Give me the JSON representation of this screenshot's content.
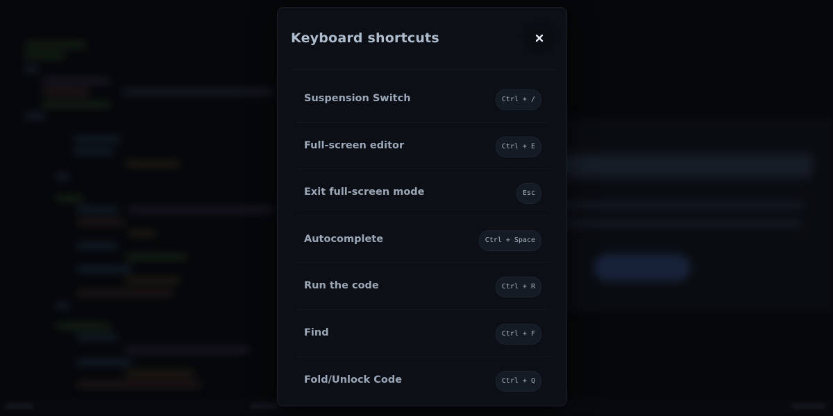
{
  "modal": {
    "title": "Keyboard shortcuts",
    "close_icon": "close-icon"
  },
  "shortcuts": [
    {
      "label": "Suspension Switch",
      "keys": "Ctrl + /"
    },
    {
      "label": "Full-screen editor",
      "keys": "Ctrl + E"
    },
    {
      "label": "Exit full-screen mode",
      "keys": "Esc"
    },
    {
      "label": "Autocomplete",
      "keys": "Ctrl + Space"
    },
    {
      "label": "Run the code",
      "keys": "Ctrl + R"
    },
    {
      "label": "Find",
      "keys": "Ctrl + F"
    },
    {
      "label": "Fold/Unlock Code",
      "keys": "Ctrl + Q"
    }
  ],
  "colors": {
    "modal_bg": "#0c1016",
    "title": "#aebccd",
    "label": "#9ba7b7",
    "kbd_bg": "#151b24"
  }
}
